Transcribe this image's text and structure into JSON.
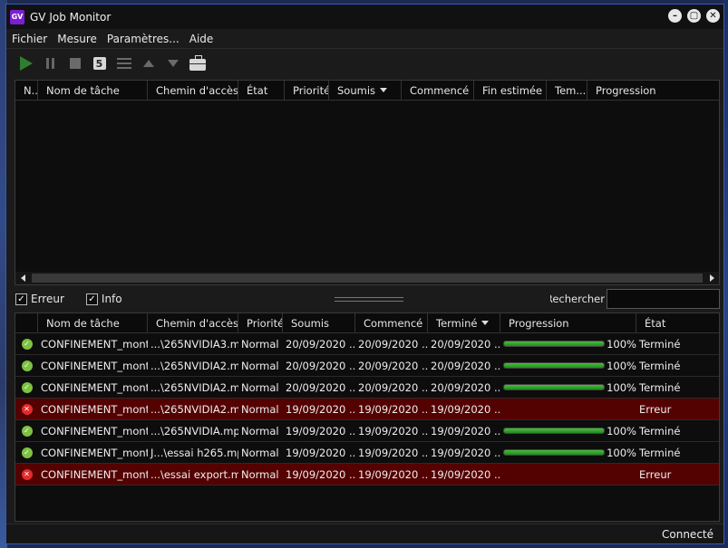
{
  "window": {
    "title": "GV Job Monitor",
    "icon_text": "GV",
    "controls": [
      "minimize",
      "maximize",
      "close"
    ]
  },
  "menu": [
    {
      "label": "Fichier"
    },
    {
      "label": "Mesure"
    },
    {
      "label": "Paramètres..."
    },
    {
      "label": "Aide"
    }
  ],
  "toolbar": {
    "icons": [
      "play-icon",
      "pause-icon",
      "stop-icon",
      "refresh-icon",
      "list-icon",
      "move-up-icon",
      "move-down-icon",
      "briefcase-icon"
    ],
    "refresh_glyph": "5"
  },
  "queue_table": {
    "columns": [
      "N...",
      "Nom de tâche",
      "Chemin d'accès ...",
      "État",
      "Priorité",
      "Soumis",
      "Commencé",
      "Fin estimée",
      "Tem...",
      "Progression"
    ],
    "rows": []
  },
  "filters": {
    "error_label": "Erreur",
    "error_checked": true,
    "info_label": "Info",
    "info_checked": true,
    "search_label": "Rechercher",
    "search_value": ""
  },
  "history_table": {
    "columns": [
      "Nom de tâche",
      "Chemin d'accès ...",
      "Priorité",
      "Soumis",
      "Commencé",
      "Terminé",
      "Progression",
      "État"
    ],
    "rows": [
      {
        "status": "ok",
        "name": "CONFINEMENT_mont...",
        "path": "...\\265NVIDIA3.mp4",
        "priority": "Normal",
        "submitted": "20/09/2020 ...",
        "started": "20/09/2020 ...",
        "finished": "20/09/2020 ...",
        "progress": 100,
        "progress_label": "100%",
        "state": "Terminé"
      },
      {
        "status": "ok",
        "name": "CONFINEMENT_mont...",
        "path": "...\\265NVIDIA2.mp4",
        "priority": "Normal",
        "submitted": "20/09/2020 ...",
        "started": "20/09/2020 ...",
        "finished": "20/09/2020 ...",
        "progress": 100,
        "progress_label": "100%",
        "state": "Terminé"
      },
      {
        "status": "ok",
        "name": "CONFINEMENT_mont...",
        "path": "...\\265NVIDIA2.mp4",
        "priority": "Normal",
        "submitted": "20/09/2020 ...",
        "started": "20/09/2020 ...",
        "finished": "20/09/2020 ...",
        "progress": 100,
        "progress_label": "100%",
        "state": "Terminé"
      },
      {
        "status": "error",
        "name": "CONFINEMENT_mont...",
        "path": "...\\265NVIDIA2.mp4",
        "priority": "Normal",
        "submitted": "19/09/2020 ...",
        "started": "19/09/2020 ...",
        "finished": "19/09/2020 ...",
        "progress": 0,
        "progress_label": "",
        "state": "Erreur"
      },
      {
        "status": "ok",
        "name": "CONFINEMENT_mont...",
        "path": "...\\265NVIDIA.mp4",
        "priority": "Normal",
        "submitted": "19/09/2020 ...",
        "started": "19/09/2020 ...",
        "finished": "19/09/2020 ...",
        "progress": 100,
        "progress_label": "100%",
        "state": "Terminé"
      },
      {
        "status": "ok",
        "name": "CONFINEMENT_mont...",
        "path": "J...\\essai h265.mp4",
        "priority": "Normal",
        "submitted": "19/09/2020 ...",
        "started": "19/09/2020 ...",
        "finished": "19/09/2020 ...",
        "progress": 100,
        "progress_label": "100%",
        "state": "Terminé"
      },
      {
        "status": "error",
        "name": "CONFINEMENT_mont...",
        "path": "...\\essai export.mp4",
        "priority": "Normal",
        "submitted": "19/09/2020 ...",
        "started": "19/09/2020 ...",
        "finished": "19/09/2020 ...",
        "progress": 0,
        "progress_label": "",
        "state": "Erreur"
      }
    ]
  },
  "statusbar": {
    "text": "Connecté"
  },
  "colors": {
    "accent_border": "#3a56b8",
    "error_row": "#540101",
    "progress_green": "#2f9d2f",
    "ok_icon": "#7ec242",
    "error_icon": "#e32b2b",
    "app_icon": "#7b1fd1"
  }
}
